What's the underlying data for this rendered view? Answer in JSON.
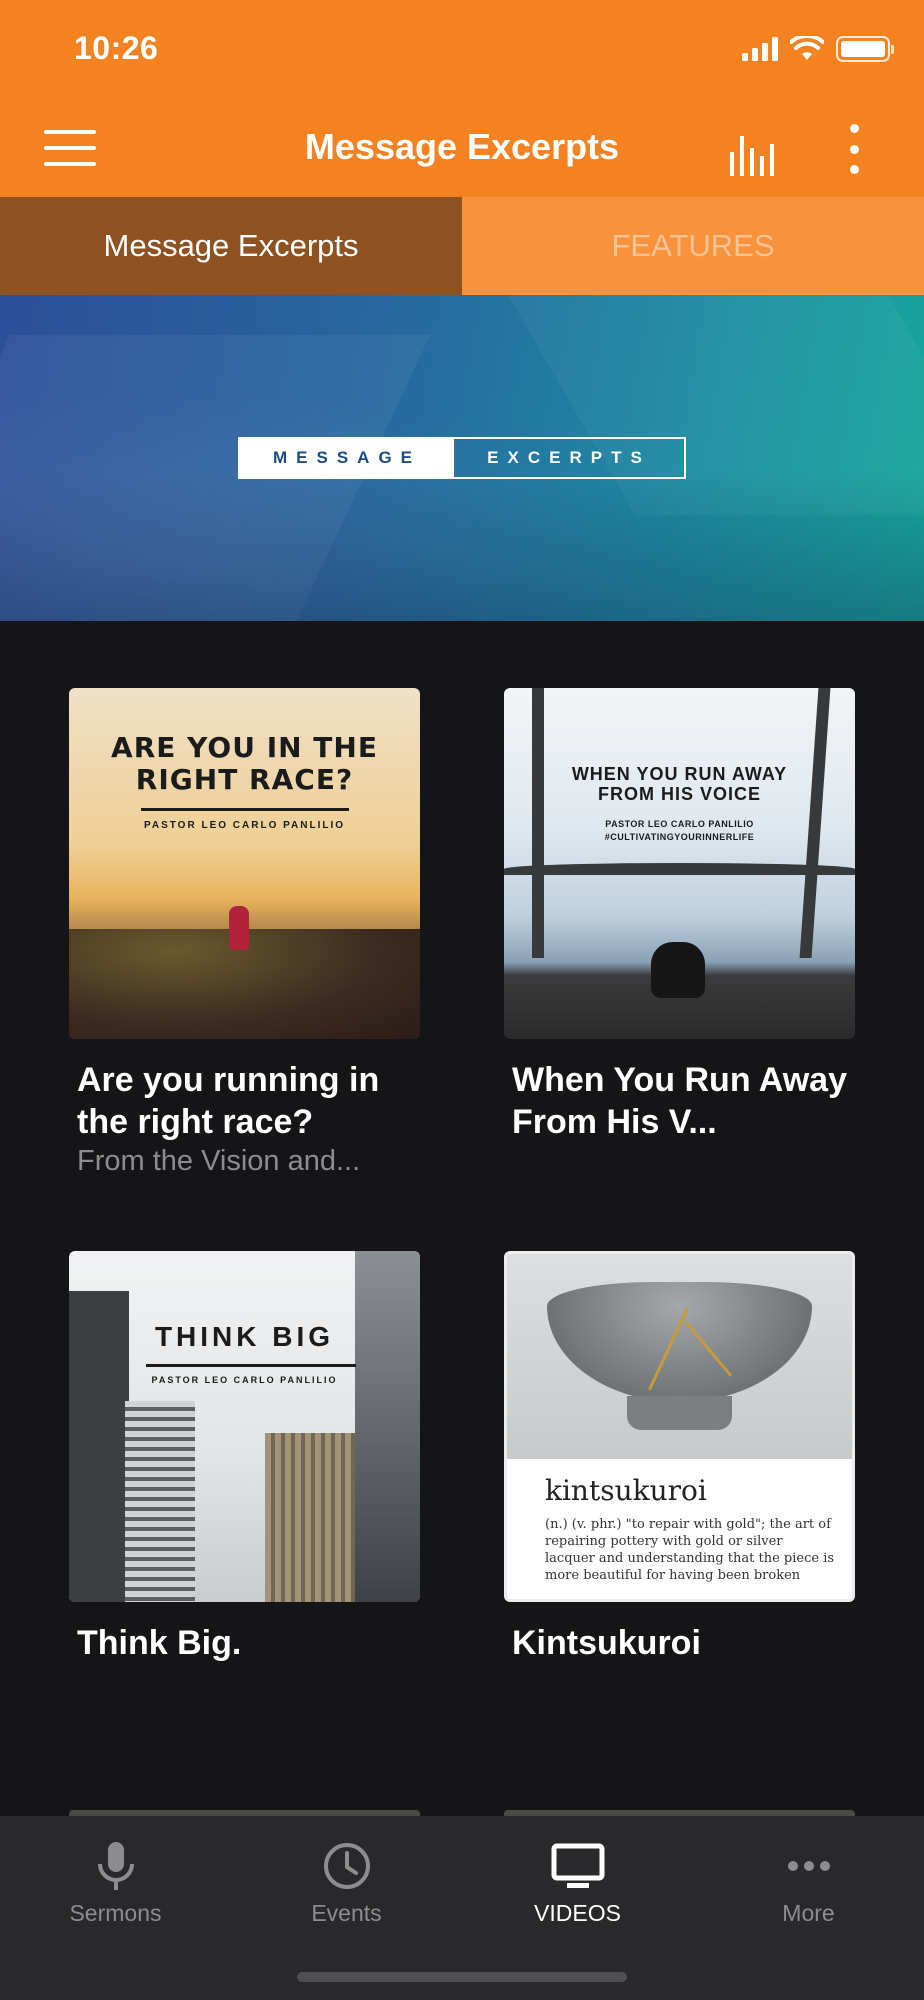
{
  "status_bar": {
    "time": "10:26",
    "icons": [
      "signal-icon",
      "wifi-icon",
      "battery-icon"
    ]
  },
  "app_bar": {
    "title": "Message Excerpts",
    "icons": [
      "menu-icon",
      "audio-bars-icon",
      "more-vertical-icon"
    ]
  },
  "tabs": [
    {
      "label": "Message Excerpts",
      "active": true
    },
    {
      "label": "FEATURES",
      "active": false
    }
  ],
  "banner": {
    "word_a": "MESSAGE",
    "word_b": "EXCERPTS"
  },
  "cards": [
    {
      "title": "Are you running in the right race?",
      "subtitle": "From the Vision and...",
      "thumb": {
        "heading_line1": "ARE YOU IN THE",
        "heading_line2": "RIGHT RACE?",
        "byline": "PASTOR LEO CARLO PANLILIO"
      }
    },
    {
      "title": "When You Run Away From His V...",
      "subtitle": "",
      "thumb": {
        "heading_line1": "WHEN YOU RUN AWAY",
        "heading_line2": "FROM HIS VOICE",
        "byline": "PASTOR LEO CARLO PANLILIO",
        "hashtag": "#CULTIVATINGYOURINNERLIFE"
      }
    },
    {
      "title": "Think Big.",
      "subtitle": "",
      "thumb": {
        "heading": "THINK BIG",
        "byline": "PASTOR LEO CARLO PANLILIO"
      }
    },
    {
      "title": "Kintsukuroi",
      "subtitle": "",
      "thumb": {
        "word": "kintsukuroi",
        "definition": "(n.) (v. phr.) \"to repair with gold\"; the art of repairing pottery with gold or silver lacquer and understanding that the piece is more beautiful for having been broken"
      }
    }
  ],
  "bottom_nav": [
    {
      "label": "Sermons",
      "icon": "microphone-icon",
      "active": false
    },
    {
      "label": "Events",
      "icon": "clock-icon",
      "active": false
    },
    {
      "label": "VIDEOS",
      "icon": "tv-icon",
      "active": true
    },
    {
      "label": "More",
      "icon": "more-horizontal-icon",
      "active": false
    }
  ],
  "colors": {
    "brand_orange": "#f58220",
    "active_tab": "#8e5222",
    "inactive_tab": "#f8923c",
    "background": "#151517",
    "nav_background": "#29292b"
  }
}
